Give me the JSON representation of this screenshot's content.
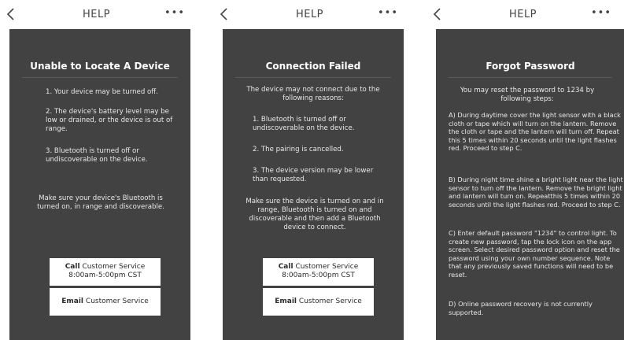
{
  "screens": [
    {
      "header": {
        "title": "HELP",
        "more": "•••"
      },
      "title": "Unable to Locate A Device",
      "paragraphs": [
        "1. Your device may be turned off.",
        "2. The device's battery level may be low or drained, or the device is out of range.",
        "3. Bluetooth is turned off or undiscoverable on the device.",
        "Make sure your device's Bluetooth is turned on, in range and discoverable."
      ],
      "call_button": {
        "bold": "Call",
        "text": "Customer Service",
        "hours": "8:00am-5:00pm CST"
      },
      "email_button": {
        "bold": "Email",
        "text": "Customer Service"
      }
    },
    {
      "header": {
        "title": "HELP",
        "more": "•••"
      },
      "title": "Connection Failed",
      "paragraphs": [
        "The device may not connect due to the following reasons:",
        "1. Bluetooth is turned off or undiscoverable on the device.",
        "2. The pairing is cancelled.",
        "3. The device version may be lower than requested.",
        "Make sure the device is turned on and in range, Bluetooth is turned on and discoverable and then add a Bluetooth device to connect."
      ],
      "call_button": {
        "bold": "Call",
        "text": "Customer Service",
        "hours": "8:00am-5:00pm CST"
      },
      "email_button": {
        "bold": "Email",
        "text": "Customer Service"
      }
    },
    {
      "header": {
        "title": "HELP",
        "more": "•••"
      },
      "title": "Forgot Password",
      "paragraphs": [
        "You may reset the password to 1234 by following steps:",
        "A) During daytime cover the light sensor with a black cloth or tape which will turn on the lantern. Remove the cloth or tape and the lantern will turn off. Repeat this 5 times within 20 seconds until the light flashes red. Proceed to step C.",
        "B) During night time shine a bright light near the light sensor to turn off the lantern. Remove the bright light and lantern will turn on. Repeatthis 5 times within 20 seconds until the light flashes red. Proceed to step C.",
        "C) Enter default password \"1234\" to control light. To create new password, tap the lock icon on the app screen. Select desired password option and reset the password using your own number sequence. Note that any previously saved functions will need to be reset.",
        "D) Online password recovery is not currently supported."
      ]
    }
  ]
}
